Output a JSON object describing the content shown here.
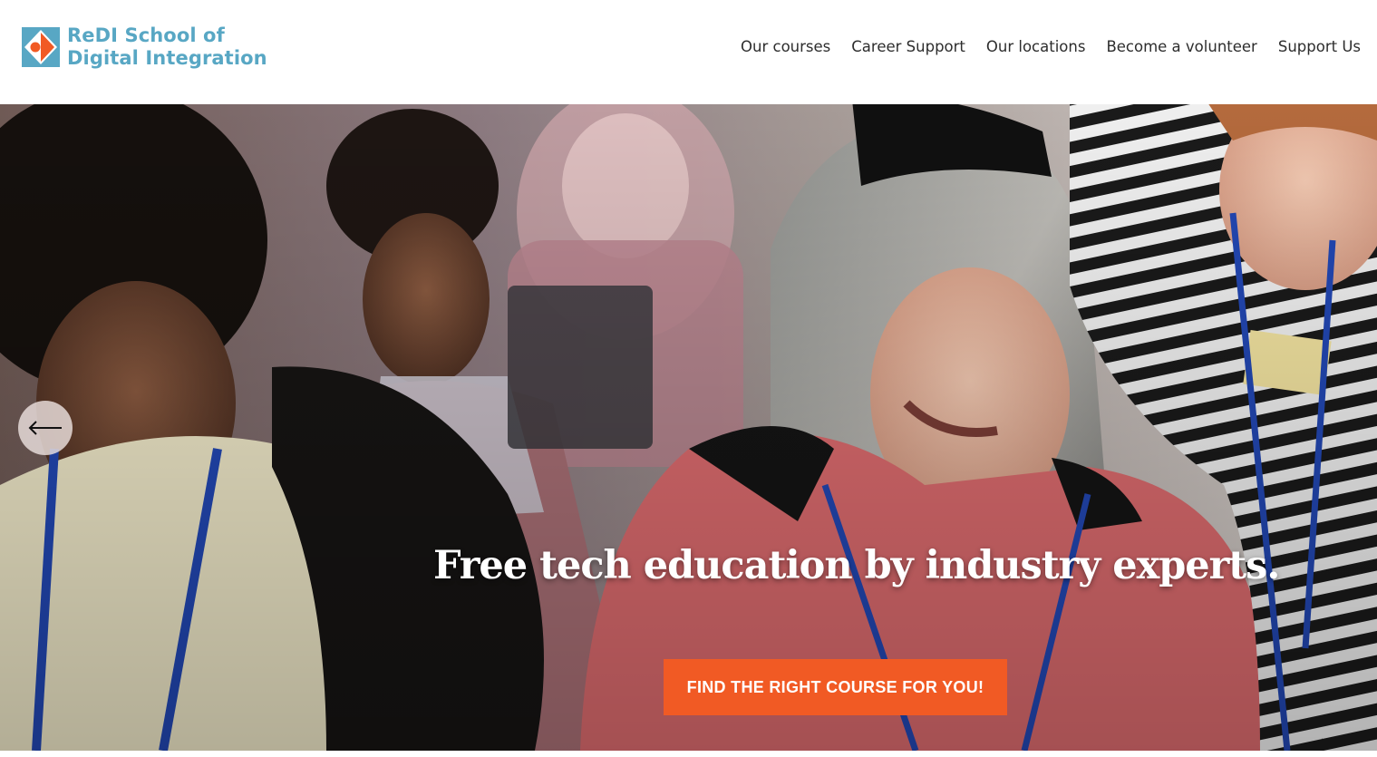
{
  "header": {
    "logo_line1": "ReDI School of",
    "logo_line2": "Digital Integration",
    "nav": [
      {
        "label": "Our courses"
      },
      {
        "label": "Career Support"
      },
      {
        "label": "Our locations"
      },
      {
        "label": "Become a volunteer"
      },
      {
        "label": "Support Us"
      }
    ]
  },
  "hero": {
    "headline": "Free tech education by industry experts.",
    "cta_label": "FIND THE RIGHT COURSE FOR YOU!",
    "prev_icon": "arrow-left-icon",
    "photo_description_icon": "hero-photo"
  },
  "colors": {
    "brand_blue": "#58a7c4",
    "brand_orange": "#f15a24",
    "nav_text": "#2d2d2d"
  }
}
